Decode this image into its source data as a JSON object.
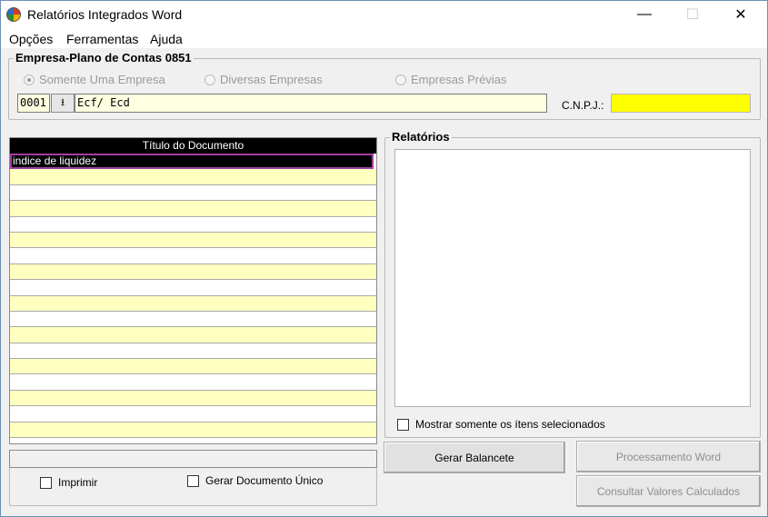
{
  "window": {
    "title": "Relatórios Integrados Word",
    "icon": "app-logo-icon",
    "controls": {
      "minimize": "—",
      "maximize": "☐",
      "close": "✕"
    }
  },
  "menu": {
    "items": [
      {
        "label": "Opções"
      },
      {
        "label": "Ferramentas"
      },
      {
        "label": "Ajuda"
      }
    ]
  },
  "empresa": {
    "group_title": "Empresa-Plano de Contas 0851",
    "radio_somente": "Somente Uma Empresa",
    "radio_diversas": "Diversas Empresas",
    "radio_previas": "Empresas Prévias",
    "selected_radio": "Somente Uma Empresa",
    "code_value": "0001",
    "name_value": "Ecf/ Ecd",
    "cnpj_label": "C.N.P.J.:",
    "cnpj_value": "",
    "colors": {
      "cnpj_bg": "#ffff00",
      "field_bg": "#ffffe1"
    }
  },
  "documents": {
    "header": "Título do Documento",
    "rows": [
      "indice de liquidez",
      "",
      "",
      "",
      "",
      "",
      "",
      "",
      "",
      "",
      "",
      "",
      "",
      "",
      "",
      "",
      "",
      ""
    ],
    "selected_index": 0,
    "imprimir_label": "Imprimir",
    "gerar_unico_label": "Gerar Documento Único"
  },
  "relatorios": {
    "group_title": "Relatórios",
    "mostrar_label": "Mostrar somente os ítens selecionados"
  },
  "buttons": {
    "gerar_balancete": "Gerar Balancete",
    "processamento_word": "Processamento Word",
    "consultar_valores": "Consultar Valores Calculados"
  }
}
